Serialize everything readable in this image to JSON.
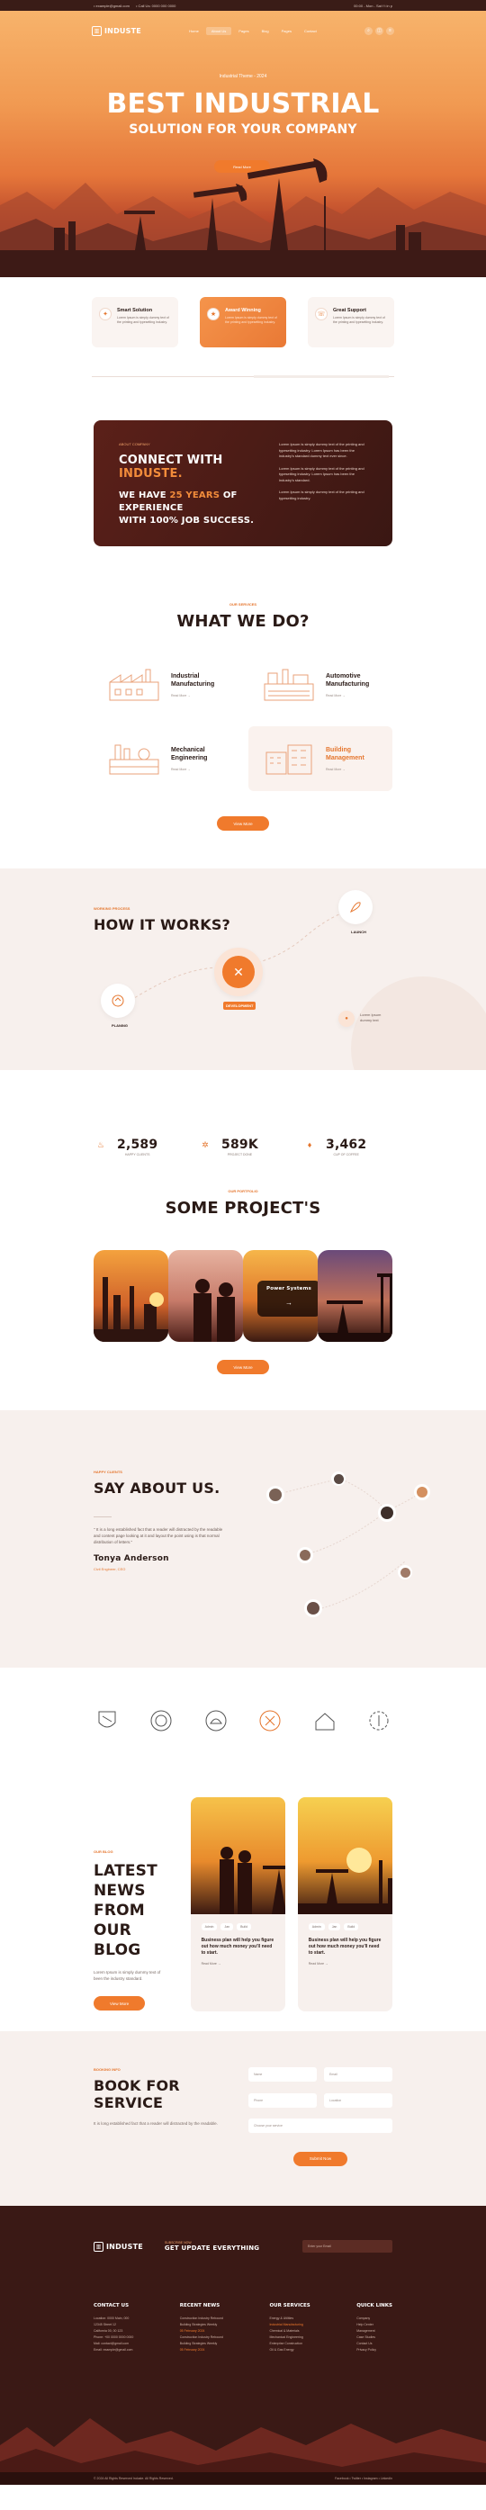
{
  "topbar": {
    "left": [
      "•  example@gmail.com",
      "•  Call Us: 0000 000 0000"
    ],
    "right": "00:00 - Mon - Sat  f  t  in  p"
  },
  "brand": {
    "name": "INDUSTE"
  },
  "nav": {
    "items": [
      "Home",
      "About Us",
      "Pages",
      "Blog",
      "Pages",
      "Contact"
    ],
    "active_index": 1
  },
  "hero": {
    "subtitle": "Industrial Theme - 2024",
    "title": "BEST INDUSTRIAL",
    "title2": "SOLUTION FOR YOUR COMPANY",
    "cta": "Read More"
  },
  "features": [
    {
      "title": "Smart Solution",
      "text": "Lorem Ipsum is simply dummy text of the printing and typesetting industry."
    },
    {
      "title": "Award Winning",
      "text": "Lorem Ipsum is simply dummy text of the printing and typesetting industry."
    },
    {
      "title": "Great Support",
      "text": "Lorem Ipsum is simply dummy text of the printing and typesetting industry."
    }
  ],
  "connect": {
    "tag": "ABOUT COMPANY",
    "title_a": "CONNECT WITH ",
    "title_b": "INDUSTE.",
    "line1_a": "WE HAVE ",
    "line1_b": "25 YEARS",
    "line1_c": " OF EXPERIENCE",
    "line2": "WITH 100% JOB SUCCESS.",
    "paras": [
      "Lorem Ipsum is simply dummy text of the printing and typesetting industry. Lorem Ipsum has been the industry's standard dummy text ever since.",
      "Lorem Ipsum is simply dummy text of the printing and typesetting industry. Lorem Ipsum has been the industry's standard.",
      "Lorem Ipsum is simply dummy text of the printing and typesetting industry."
    ]
  },
  "services": {
    "tag": "OUR SERVICES",
    "title": "WHAT WE DO?",
    "items": [
      {
        "title1": "Industrial",
        "title2": "Manufacturing",
        "more": "Read More  →"
      },
      {
        "title1": "Automotive",
        "title2": "Manufacturing",
        "more": "Read More  →"
      },
      {
        "title1": "Mechanical",
        "title2": "Engineering",
        "more": "Read More  →"
      },
      {
        "title1": "Building",
        "title2": "Management",
        "more": "Read More  →"
      }
    ],
    "button": "View More"
  },
  "how": {
    "tag": "WORKING PROCESS",
    "title": "HOW IT WORKS?",
    "steps": [
      "PLANING",
      "DEVELOPMENT",
      "LAUNCH"
    ],
    "info1": "Lorem Ipsum",
    "info2": "dummy text"
  },
  "stats": [
    {
      "value": "2,589",
      "label": "HAPPY CLIENTS",
      "icon": "thumb-icon"
    },
    {
      "value": "589K",
      "label": "PROJECT DONE",
      "icon": "gear-icon"
    },
    {
      "value": "3,462",
      "label": "CUP OF COFFEE",
      "icon": "flame-icon"
    }
  ],
  "projects": {
    "tag": "OUR PORTFOLIO",
    "title": "SOME PROJECT'S",
    "overlay_title": "Power Systems",
    "overlay_arrow": "→",
    "button": "View More"
  },
  "testimonials": {
    "tag": "HAPPY CLIENTS",
    "title": "SAY ABOUT US.",
    "quote": "\" It is a long established fact that a reader will distracted by the readable and content page looking at it and layout the point using is that normal distribution of letters.\"",
    "name": "Tonya Anderson",
    "role": "Civil Engineer, CEO"
  },
  "news": {
    "tag": "OUR BLOG",
    "title1": "LATEST NEWS",
    "title2": "FROM OUR BLOG",
    "text": "Lorem Ipsum is simply dummy text of been the industry standard.",
    "button": "View More",
    "cards": [
      {
        "meta": [
          "Admin",
          "Jan",
          "Build"
        ],
        "title": "Business plan will help you figure out how much money you'll need to start.",
        "more": "Read More  →"
      },
      {
        "meta": [
          "Admin",
          "Jan",
          "Build"
        ],
        "title": "Business plan will help you figure out how much money you'll need to start.",
        "more": "Read More  →"
      }
    ]
  },
  "booking": {
    "tag": "BOOKING INFO",
    "title": "BOOK FOR SERVICE",
    "text": "It is long established fact that a reader will distracted by the readable.",
    "fields": [
      "Name",
      "Email",
      "Phone",
      "Location",
      "Choose your service"
    ],
    "button": "Submit Now"
  },
  "footer": {
    "sub_tag": "SUBSCRIBE NOW",
    "sub_title": "GET UPDATE EVERYTHING",
    "email_placeholder": "Enter your Email",
    "cols": [
      {
        "title": "CONTACT US",
        "lines": [
          "Location: 0000 Main, 000",
          "12345 Street 12",
          "California 00, 00 123",
          "Phone: +00 0000 0000 0000",
          "Mail: contact@gmail.com",
          "Email: example@gmail.com"
        ]
      },
      {
        "title": "RECENT NEWS",
        "lines": [
          "Construction Industry Rebound",
          "Building Strategies Weekly",
          "05 February 2024",
          "Construction Industry Rebound",
          "Building Strategies Weekly",
          "05 February 2024"
        ]
      },
      {
        "title": "OUR SERVICES",
        "lines": [
          "Energy & Utilities",
          "Industrial Manufacturing",
          "Chemical & Materials",
          "Mechanical Engineering",
          "Enterprise Construction",
          "Oil & Gas Energy"
        ]
      },
      {
        "title": "QUICK LINKS",
        "lines": [
          "Company",
          "Help Center",
          "Management",
          "Case Studies",
          "Contact Us",
          "Privacy Policy"
        ]
      }
    ],
    "copyright": "© 2024 All Rights Reserved Induste. All Rights Reserved.",
    "links": "Facebook   •   Twitter   •   Instagram   •   LinkedIn"
  },
  "colors": {
    "accent": "#f07a2c",
    "dark": "#3a1915"
  }
}
